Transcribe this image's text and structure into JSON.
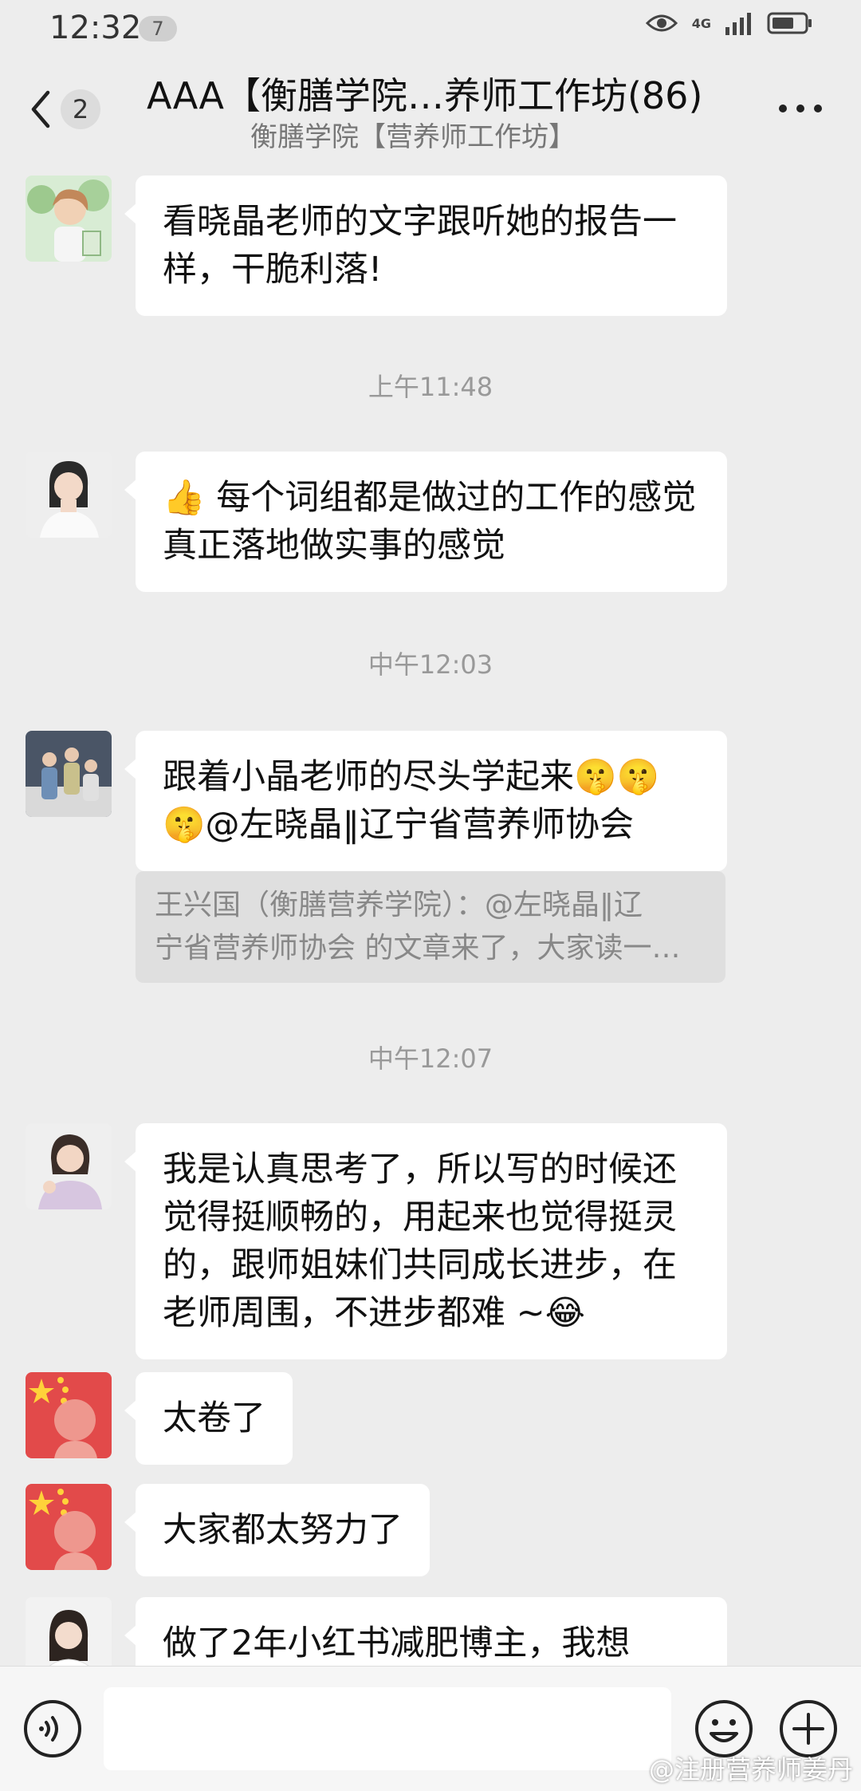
{
  "status_bar": {
    "time": "12:32",
    "notification_count": "7",
    "network": "4G"
  },
  "header": {
    "back_count": "2",
    "title": "AAA【衡膳学院…养师工作坊(86)",
    "subtitle": "衡膳学院【营养师工作坊】"
  },
  "messages": [
    {
      "text": "看晓晶老师的文字跟听她的报告一样，干脆利落!"
    },
    {
      "timestamp": "上午11:48"
    },
    {
      "text": "👍 每个词组都是做过的工作的感觉 真正落地做实事的感觉"
    },
    {
      "timestamp": "中午12:03"
    },
    {
      "text": "跟着小晶老师的尽头学起来🤫🤫🤫@左晓晶‖辽宁省营养师协会"
    },
    {
      "quote_line1": "王兴国（衡膳营养学院）：@左晓晶‖辽",
      "quote_line2": "宁省营养师协会 的文章来了，大家读一…"
    },
    {
      "timestamp": "中午12:07"
    },
    {
      "text": "我是认真思考了，所以写的时候还觉得挺顺畅的，用起来也觉得挺灵的，跟师姐妹们共同成长进步，在老师周围，不进步都难 ~😂"
    },
    {
      "text": "太卷了"
    },
    {
      "text": "大家都太努力了"
    },
    {
      "text": "做了2年小红书减肥博主，我想"
    }
  ],
  "watermark": "@注册营养师姜丹",
  "colors": {
    "background": "#ededed",
    "bubble": "#ffffff",
    "quote": "#dfdfdf"
  }
}
